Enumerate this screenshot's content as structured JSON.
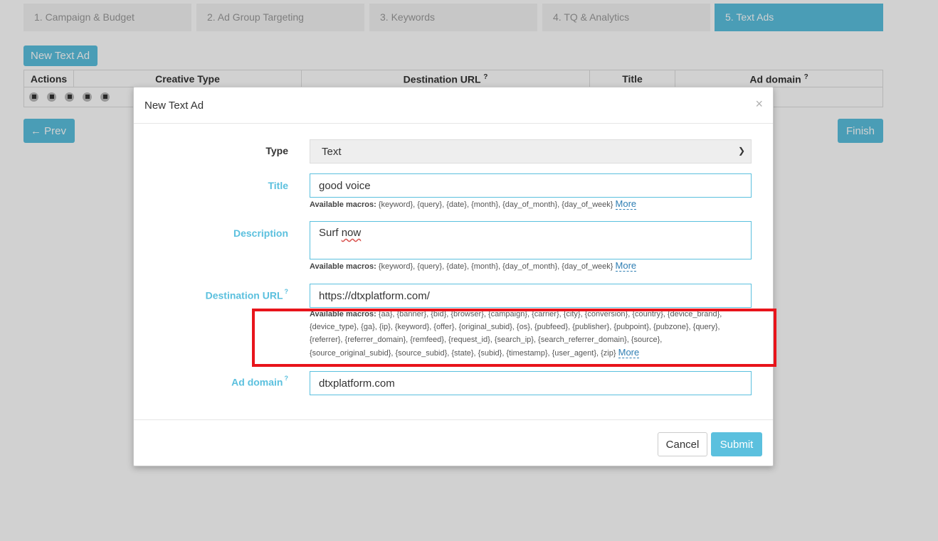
{
  "wizard": {
    "steps": [
      {
        "label": "1. Campaign & Budget"
      },
      {
        "label": "2. Ad Group Targeting"
      },
      {
        "label": "3. Keywords"
      },
      {
        "label": "4. TQ & Analytics"
      },
      {
        "label": "5. Text Ads"
      }
    ],
    "active_step": 4
  },
  "page": {
    "new_ad_label": "New Text Ad",
    "columns": [
      "Actions",
      "Creative Type",
      "Destination URL",
      "Title",
      "Ad domain"
    ],
    "help_mark": "?",
    "prev_label": "Prev",
    "finish_label": "Finish"
  },
  "modal": {
    "title": "New Text Ad",
    "close_glyph": "×",
    "type": {
      "label": "Type",
      "value": "Text"
    },
    "title_field": {
      "label": "Title",
      "value": "good voice",
      "macros_label": "Available macros:",
      "macros": "{keyword}, {query}, {date}, {month}, {day_of_month}, {day_of_week}",
      "more": "More"
    },
    "description": {
      "label": "Description",
      "value_prefix": "Surf ",
      "value_misspelled": "now",
      "macros_label": "Available macros:",
      "macros": "{keyword}, {query}, {date}, {month}, {day_of_month}, {day_of_week}",
      "more": "More"
    },
    "destination_url": {
      "label": "Destination URL",
      "value": "https://dtxplatform.com/",
      "macros_label": "Available macros:",
      "macros_line1": "{aa}, {banner}, {bid}, {browser}, {campaign}, {carrier}, {city}, {conversion}, {country}, {device_brand},",
      "macros_line2": "{device_type}, {ga}, {ip}, {keyword}, {offer}, {original_subid}, {os}, {pubfeed}, {publisher}, {pubpoint}, {pubzone}, {query},",
      "macros_line3": "{referrer}, {referrer_domain}, {remfeed}, {request_id}, {search_ip}, {search_referrer_domain}, {source},",
      "macros_line4": "{source_original_subid}, {source_subid}, {state}, {subid}, {timestamp}, {user_agent}, {zip}",
      "more": "More"
    },
    "ad_domain": {
      "label": "Ad domain",
      "value": "dtxplatform.com"
    },
    "cancel_label": "Cancel",
    "submit_label": "Submit"
  },
  "colors": {
    "accent": "#5bc0de",
    "highlight": "#e8141b"
  }
}
